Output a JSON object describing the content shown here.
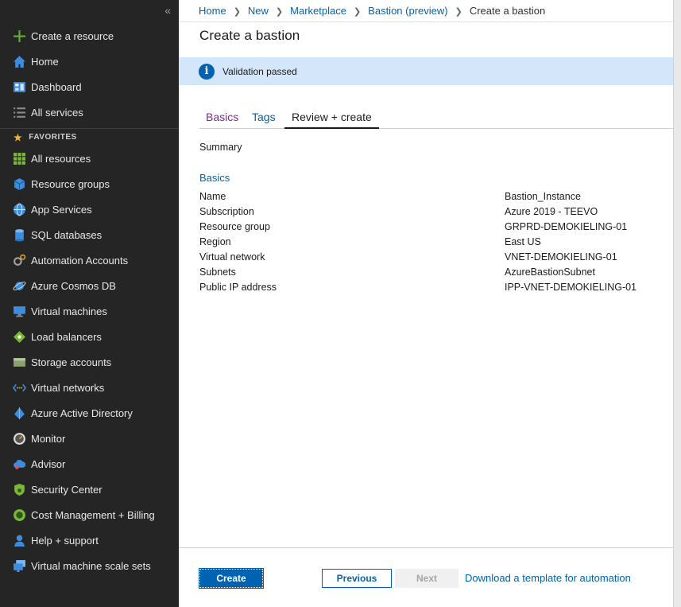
{
  "sidebar": {
    "collapse_glyph": "«",
    "items": [
      {
        "label": "Create a resource",
        "icon": "plus-icon",
        "color": "#5fb236"
      },
      {
        "label": "Home",
        "icon": "home-icon",
        "color": "#3d8ddf"
      },
      {
        "label": "Dashboard",
        "icon": "dashboard-icon",
        "color": "#3d8ddf"
      },
      {
        "label": "All services",
        "icon": "list-icon",
        "color": "#8a8a8a"
      }
    ],
    "favorites_label": "FAVORITES",
    "favorites": [
      {
        "label": "All resources",
        "icon": "grid-icon",
        "color": "#7bb83a"
      },
      {
        "label": "Resource groups",
        "icon": "cube-icon",
        "color": "#3d8ddf"
      },
      {
        "label": "App Services",
        "icon": "globe-icon",
        "color": "#3d8ddf"
      },
      {
        "label": "SQL databases",
        "icon": "database-icon",
        "color": "#3d8ddf"
      },
      {
        "label": "Automation Accounts",
        "icon": "gears-icon",
        "color": "#a0a0a0"
      },
      {
        "label": "Azure Cosmos DB",
        "icon": "planet-icon",
        "color": "#3d8ddf"
      },
      {
        "label": "Virtual machines",
        "icon": "monitor-icon",
        "color": "#3d8ddf"
      },
      {
        "label": "Load balancers",
        "icon": "diamond-icon",
        "color": "#7bb83a"
      },
      {
        "label": "Storage accounts",
        "icon": "storage-icon",
        "color": "#8aa070"
      },
      {
        "label": "Virtual networks",
        "icon": "network-icon",
        "color": "#7bb83a"
      },
      {
        "label": "Azure Active Directory",
        "icon": "pyramid-icon",
        "color": "#3d8ddf"
      },
      {
        "label": "Monitor",
        "icon": "gauge-icon",
        "color": "#dcdcdc"
      },
      {
        "label": "Advisor",
        "icon": "cloud-icon",
        "color": "#3d8ddf"
      },
      {
        "label": "Security Center",
        "icon": "shield-icon",
        "color": "#7bb83a"
      },
      {
        "label": "Cost Management + Billing",
        "icon": "coin-icon",
        "color": "#7bb83a"
      },
      {
        "label": "Help + support",
        "icon": "person-icon",
        "color": "#3d8ddf"
      },
      {
        "label": "Virtual machine scale sets",
        "icon": "scale-sets-icon",
        "color": "#3d8ddf"
      }
    ]
  },
  "breadcrumb": [
    "Home",
    "New",
    "Marketplace",
    "Bastion (preview)",
    "Create a bastion"
  ],
  "page": {
    "title": "Create a bastion",
    "banner": "Validation passed",
    "tabs": [
      "Basics",
      "Tags",
      "Review + create"
    ],
    "summary": "Summary",
    "section": "Basics",
    "rows": [
      {
        "label": "Name",
        "value": "Bastion_Instance"
      },
      {
        "label": "Subscription",
        "value": "Azure 2019 - TEEVO"
      },
      {
        "label": "Resource group",
        "value": "GRPRD-DEMOKIELING-01"
      },
      {
        "label": "Region",
        "value": "East US"
      },
      {
        "label": "Virtual network",
        "value": "VNET-DEMOKIELING-01"
      },
      {
        "label": "Subnets",
        "value": "AzureBastionSubnet"
      },
      {
        "label": "Public IP address",
        "value": "IPP-VNET-DEMOKIELING-01"
      }
    ]
  },
  "footer": {
    "create": "Create",
    "previous": "Previous",
    "next": "Next",
    "template_link": "Download a template for automation"
  },
  "colors": {
    "accent": "#0063b1",
    "sidebar_bg": "#252526",
    "banner_bg": "#d3e6fa"
  }
}
